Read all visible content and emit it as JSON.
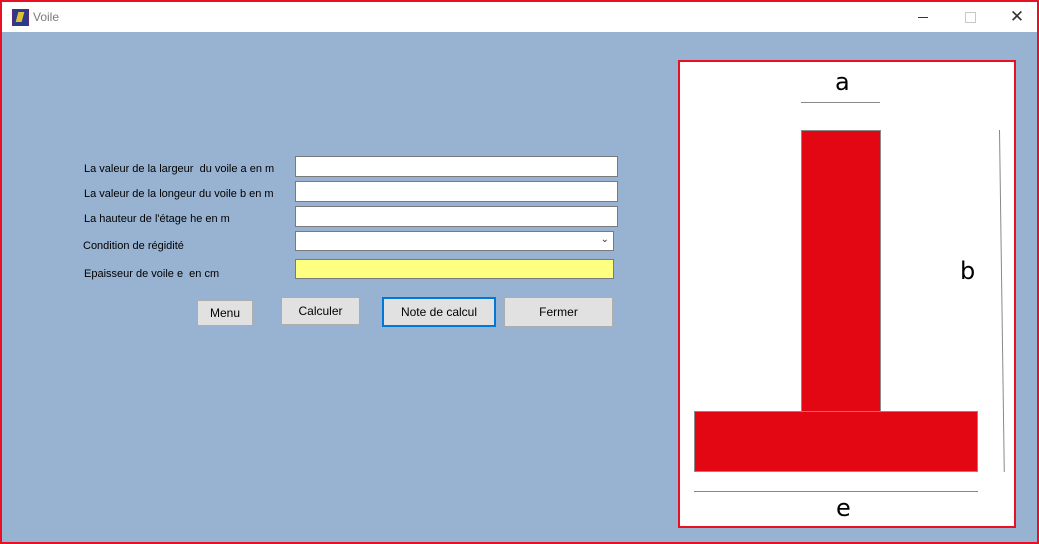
{
  "window": {
    "title": "Voile",
    "controls": {
      "minimize": "minimize",
      "maximize": "maximize",
      "close": "close"
    }
  },
  "form": {
    "largeur_label": "La valeur de la largeur  du voile a en m",
    "largeur_value": "",
    "longueur_label": "La valeur de la longeur du voile b en m",
    "longueur_value": "",
    "hauteur_label": "La hauteur de l'étage he en m",
    "hauteur_value": "",
    "condition_label": "Condition de régidité",
    "condition_value": "",
    "epaisseur_label": "Epaisseur de voile e  en cm",
    "epaisseur_value": ""
  },
  "buttons": {
    "menu": "Menu",
    "calculer": "Calculer",
    "note": "Note de calcul",
    "fermer": "Fermer"
  },
  "diagram": {
    "label_a": "a",
    "label_b": "b",
    "label_e": "e",
    "fill_color": "#e30613"
  }
}
